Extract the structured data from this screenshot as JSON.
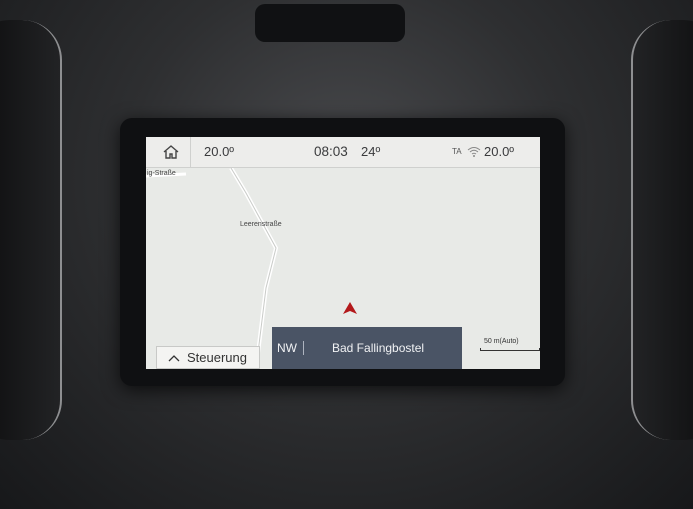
{
  "status_bar": {
    "temp_left": "20.0º",
    "time": "08:03",
    "outside_temp": "24º",
    "ta_label": "TA",
    "temp_right": "20.0º"
  },
  "map": {
    "street_top": "ig-Straße",
    "street_mid": "Leerenstraße"
  },
  "bottom": {
    "steer_label": "Steuerung",
    "direction": "NW",
    "destination": "Bad Fallingbostel",
    "scale": "50 m(Auto)"
  },
  "colors": {
    "dest_bar": "#4a5465",
    "car_arrow": "#b3191b",
    "screen_bg": "#e6e8e5"
  },
  "icons": {
    "home": "home-icon",
    "wifi": "wifi-icon",
    "steer": "chevron-up-icon",
    "car": "navigation-arrow-icon"
  }
}
